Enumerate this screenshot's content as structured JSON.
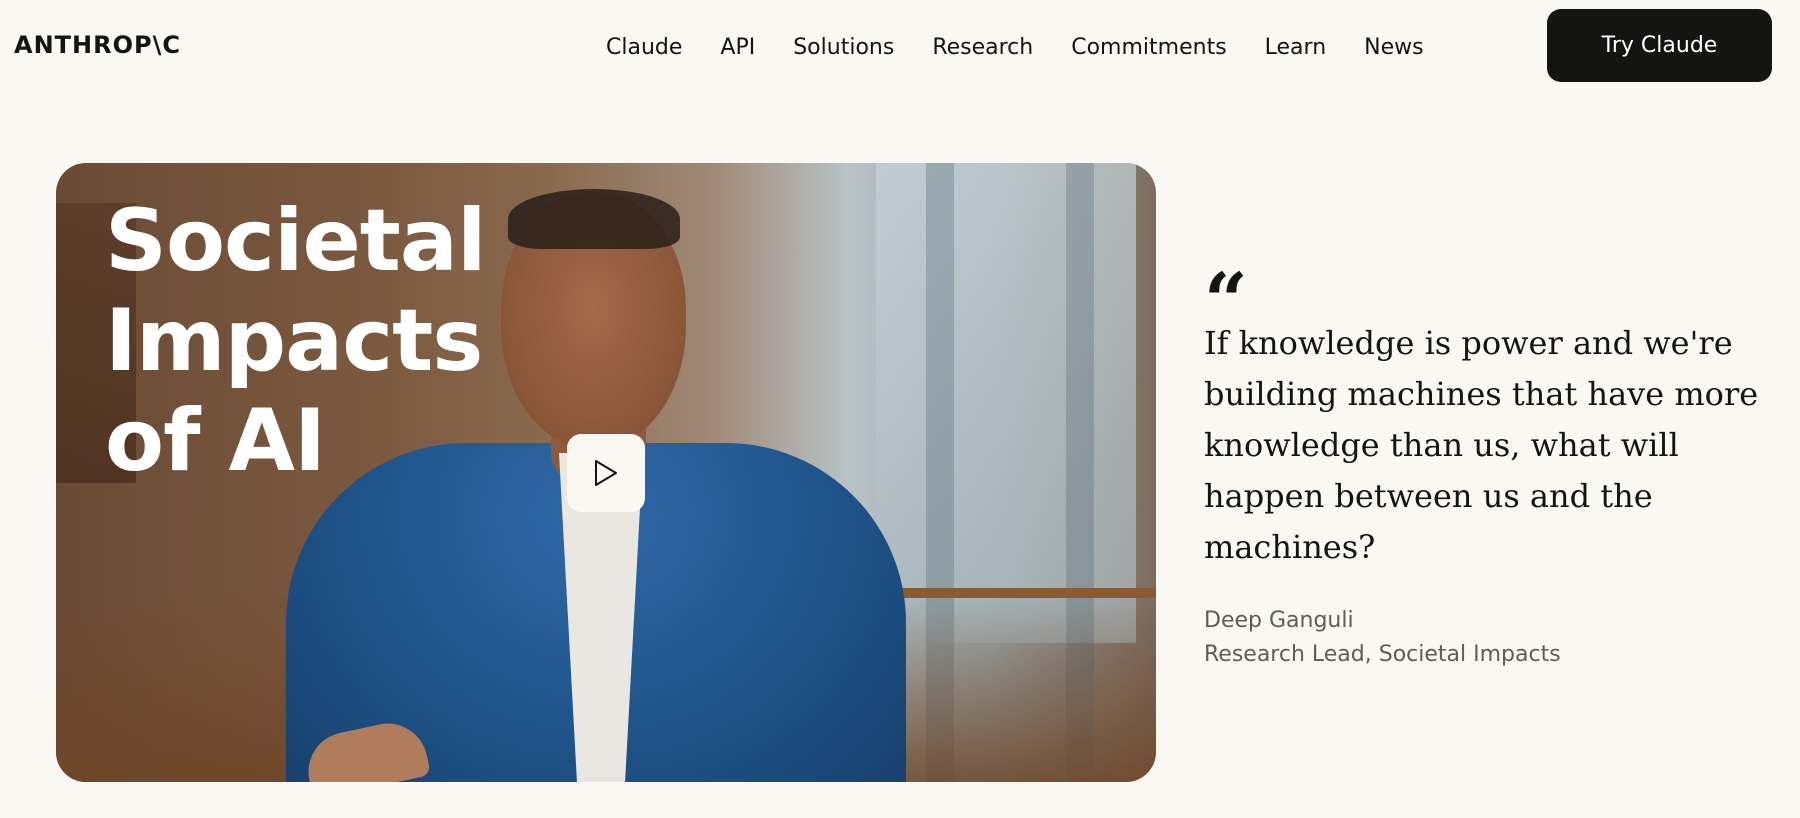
{
  "header": {
    "logo": "ANTHROP\\C",
    "nav": [
      {
        "label": "Claude"
      },
      {
        "label": "API"
      },
      {
        "label": "Solutions"
      },
      {
        "label": "Research"
      },
      {
        "label": "Commitments"
      },
      {
        "label": "Learn"
      },
      {
        "label": "News"
      }
    ],
    "cta_label": "Try Claude"
  },
  "video": {
    "title_lines": [
      "Societal",
      "Impacts",
      "of AI"
    ],
    "play_icon": "play-icon"
  },
  "quote": {
    "mark": "“",
    "text": "If knowledge is power and we're building machines that have more knowledge than us, what will happen between us and the machines?",
    "author_name": "Deep Ganguli",
    "author_role": "Research Lead, Societal Impacts"
  },
  "colors": {
    "background": "#f9f8f3",
    "text": "#141413",
    "button": "#141413",
    "muted": "#5e5d59",
    "jacket": "#1f5389"
  }
}
